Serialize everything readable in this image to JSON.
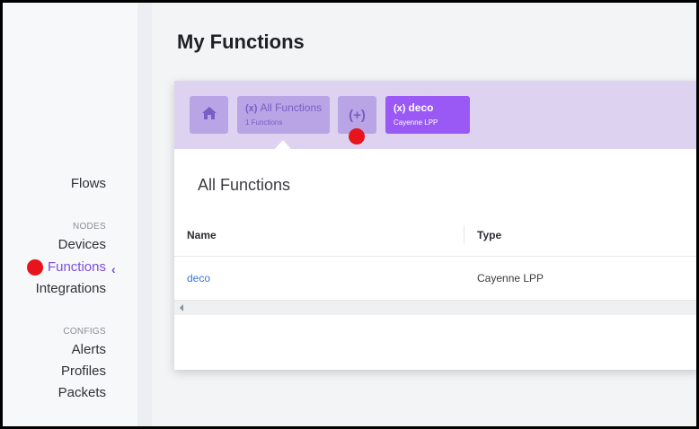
{
  "sidebar": {
    "items": [
      {
        "label": "Flows"
      },
      {
        "label": "Devices"
      },
      {
        "label": "Functions"
      },
      {
        "label": "Integrations"
      },
      {
        "label": "Alerts"
      },
      {
        "label": "Profiles"
      },
      {
        "label": "Packets"
      }
    ],
    "sections": {
      "nodes": "NODES",
      "configs": "CONFIGS"
    },
    "active_item": "Functions"
  },
  "page": {
    "title": "My Functions"
  },
  "toolbar": {
    "home_icon": "home-icon",
    "all_functions": {
      "prefix": "(x)",
      "title": "All Functions",
      "subtitle": "1 Functions"
    },
    "add_label": "(+)",
    "deco": {
      "prefix": "(x)",
      "title": "deco",
      "subtitle": "Cayenne LPP"
    }
  },
  "main": {
    "section_title": "All Functions",
    "table": {
      "columns": [
        "Name",
        "Type"
      ],
      "rows": [
        {
          "name": "deco",
          "type": "Cayenne LPP"
        }
      ]
    }
  },
  "colors": {
    "accent": "#7b4fe0",
    "toolbar_bg": "#ddd3f1",
    "button_bg": "#b9a5e6",
    "active_button_bg": "#9a59f5",
    "link": "#3e78d8",
    "marker": "#e8141c"
  }
}
